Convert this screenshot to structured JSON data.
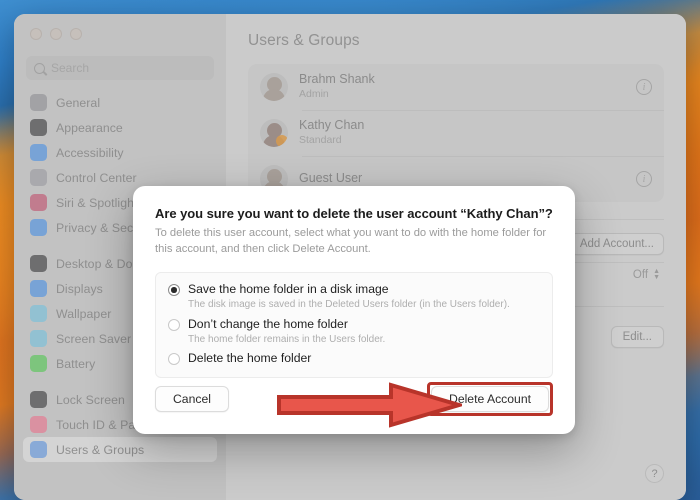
{
  "window": {
    "traffic_lights": [
      "close",
      "minimize",
      "zoom"
    ],
    "search": {
      "placeholder": "Search",
      "icon": "search-icon"
    }
  },
  "sidebar": {
    "groups": [
      {
        "items": [
          {
            "label": "General",
            "icon": "gear-icon",
            "color": "#8e8e93"
          },
          {
            "label": "Appearance",
            "icon": "appearance-icon",
            "color": "#3a3a3c"
          },
          {
            "label": "Accessibility",
            "icon": "accessibility-icon",
            "color": "#4a90e2"
          },
          {
            "label": "Control Center",
            "icon": "control-center-icon",
            "color": "#9a9a9f"
          },
          {
            "label": "Siri & Spotlight",
            "icon": "siri-icon",
            "color": "#c0506e"
          },
          {
            "label": "Privacy & Security",
            "icon": "privacy-icon",
            "color": "#4a90e2"
          }
        ]
      },
      {
        "items": [
          {
            "label": "Desktop & Dock",
            "icon": "desktop-dock-icon",
            "color": "#3a3a3c"
          },
          {
            "label": "Displays",
            "icon": "displays-icon",
            "color": "#4a90e2"
          },
          {
            "label": "Wallpaper",
            "icon": "wallpaper-icon",
            "color": "#74c0dc"
          },
          {
            "label": "Screen Saver",
            "icon": "screen-saver-icon",
            "color": "#74c0dc"
          },
          {
            "label": "Battery",
            "icon": "battery-icon",
            "color": "#53c653"
          }
        ]
      },
      {
        "items": [
          {
            "label": "Lock Screen",
            "icon": "lock-icon",
            "color": "#3a3a3c"
          },
          {
            "label": "Touch ID & Password",
            "icon": "touch-id-icon",
            "color": "#e8738c"
          },
          {
            "label": "Users & Groups",
            "icon": "users-groups-icon",
            "color": "#5a8fd8",
            "selected": true
          }
        ]
      }
    ]
  },
  "main": {
    "title": "Users & Groups",
    "users": [
      {
        "name": "Brahm Shank",
        "role": "Admin",
        "avatar": "memoji-male",
        "info": "info-icon",
        "badge": false
      },
      {
        "name": "Kathy Chan",
        "role": "Standard",
        "avatar": "memoji-female",
        "info": "",
        "badge": true
      },
      {
        "name": "Guest User",
        "role": "",
        "avatar": "guest",
        "info": "info-icon",
        "badge": false
      }
    ],
    "add_account_label": "Add Account...",
    "guest_value": "Off",
    "edit_label": "Edit...",
    "help_label": "?"
  },
  "dialog": {
    "title": "Are you sure you want to delete the user account “Kathy Chan”?",
    "body": "To delete this user account, select what you want to do with the home folder for this account, and then click Delete Account.",
    "options": [
      {
        "label": "Save the home folder in a disk image",
        "sub": "The disk image is saved in the Deleted Users folder (in the Users folder).",
        "selected": true
      },
      {
        "label": "Don’t change the home folder",
        "sub": "The home folder remains in the Users folder.",
        "selected": false
      },
      {
        "label": "Delete the home folder",
        "sub": "",
        "selected": false
      }
    ],
    "cancel_label": "Cancel",
    "confirm_label": "Delete Account"
  },
  "annotation": {
    "arrow": "right-arrow-annotation",
    "arrow_fill": "#E8564B",
    "arrow_stroke": "#B8342A",
    "highlight_stroke": "#B8342A"
  }
}
